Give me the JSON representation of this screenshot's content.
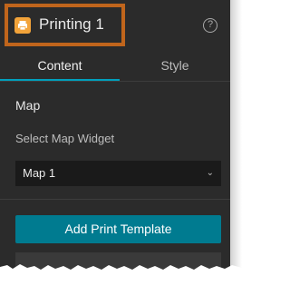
{
  "header": {
    "title": "Printing 1",
    "help_symbol": "?",
    "widget_icon": "printer-icon",
    "highlight_color": "#c0651c"
  },
  "tabs": [
    {
      "label": "Content",
      "active": true
    },
    {
      "label": "Style",
      "active": false
    }
  ],
  "map_section": {
    "heading": "Map",
    "field_label": "Select Map Widget",
    "selected_value": "Map 1"
  },
  "actions": {
    "add_template_label": "Add Print Template"
  },
  "colors": {
    "panel_bg": "#2b2b2b",
    "accent": "#00a0bd",
    "button": "#007b90",
    "icon": "#f2a33a"
  }
}
